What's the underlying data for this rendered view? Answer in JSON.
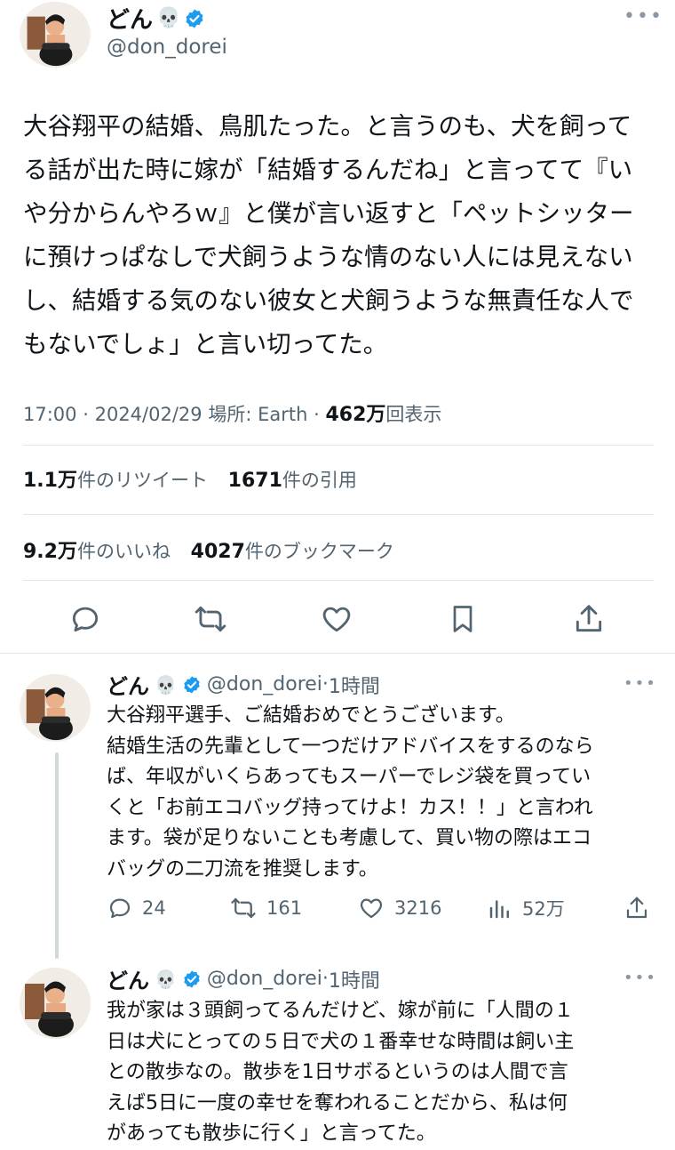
{
  "main_tweet": {
    "display_name": "どん",
    "name_emoji": "💀",
    "handle": "@don_dorei",
    "more_icon": "more-horizontal-icon",
    "lines": [
      "大谷翔平の結婚、鳥肌たった。と言うのも、犬を飼って",
      "る話が出た時に嫁が「結婚するんだね」と言ってて『い",
      "や分からんやろｗ』と僕が言い返すと「ペットシッター",
      "に預けっぱなしで犬飼うような情のない人には見えない",
      "し、結婚する気のない彼女と犬飼うような無責任な人で",
      "もないでしょ」と言い切ってた。"
    ],
    "time": "17:00",
    "sep1": "·",
    "date": "2024/02/29",
    "location_label": "場所: Earth",
    "sep2": "·",
    "views_count": "462万",
    "views_label": "回表示",
    "retweets_count": "1.1万",
    "retweets_label": "件のリツイート",
    "quotes_count": "1671",
    "quotes_label": "件の引用",
    "likes_count": "9.2万",
    "likes_label": "件のいいね",
    "bookmarks_count": "4027",
    "bookmarks_label": "件のブックマーク",
    "actions": [
      "reply-icon",
      "retweet-icon",
      "like-icon",
      "bookmark-icon",
      "share-icon"
    ]
  },
  "replies": [
    {
      "display_name": "どん",
      "name_emoji": "💀",
      "handle": "@don_dorei",
      "time_sep": "·",
      "time": "1時間",
      "lines": [
        "大谷翔平選手、ご結婚おめでとうございます。",
        "結婚生活の先輩として一つだけアドバイスをするのなら",
        "ば、年収がいくらあってもスーパーでレジ袋を買ってい",
        "くと「お前エコバッグ持ってけよ！カス！！」と言われ",
        "ます。袋が足りないことも考慮して、買い物の際はエコ",
        "バッグの二刀流を推奨します。"
      ],
      "replies_count": "24",
      "retweets_count": "161",
      "likes_count": "3216",
      "views_count": "52万"
    },
    {
      "display_name": "どん",
      "name_emoji": "💀",
      "handle": "@don_dorei",
      "time_sep": "·",
      "time": "1時間",
      "lines": [
        "我が家は３頭飼ってるんだけど、嫁が前に「人間の１",
        "日は犬にとっての５日で犬の１番幸せな時間は飼い主",
        "との散歩なの。散歩を1日サボるというのは人間で言",
        "えば5日に一度の幸せを奪われることだから、私は何",
        "があっても散歩に行く」と言ってた。"
      ]
    }
  ],
  "colors": {
    "verified": "#1d9bf0",
    "text": "#0f1419",
    "muted": "#536471",
    "divider": "#e1e8ed",
    "icon": "#536471"
  }
}
